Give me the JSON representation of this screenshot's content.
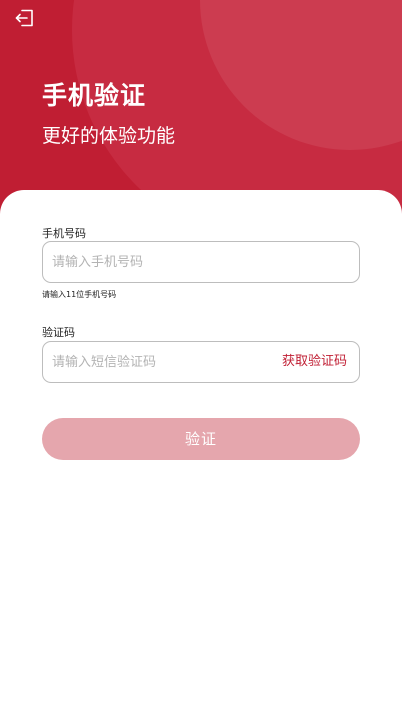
{
  "header": {
    "back_icon": "logout-arrow-icon",
    "title": "手机验证",
    "subtitle": "更好的体验功能",
    "colors": {
      "primary": "#c01e33",
      "circle_light": "#c72b41",
      "circle_lighter": "#cc3c50"
    }
  },
  "form": {
    "phone": {
      "label": "手机号码",
      "placeholder": "请输入手机号码",
      "value": "",
      "hint": "请输入11位手机号码"
    },
    "code": {
      "label": "验证码",
      "placeholder": "请输入短信验证码",
      "value": "",
      "get_code_label": "获取验证码"
    },
    "submit": {
      "label": "验证",
      "state": "disabled",
      "color": "#e5a6ad"
    }
  }
}
